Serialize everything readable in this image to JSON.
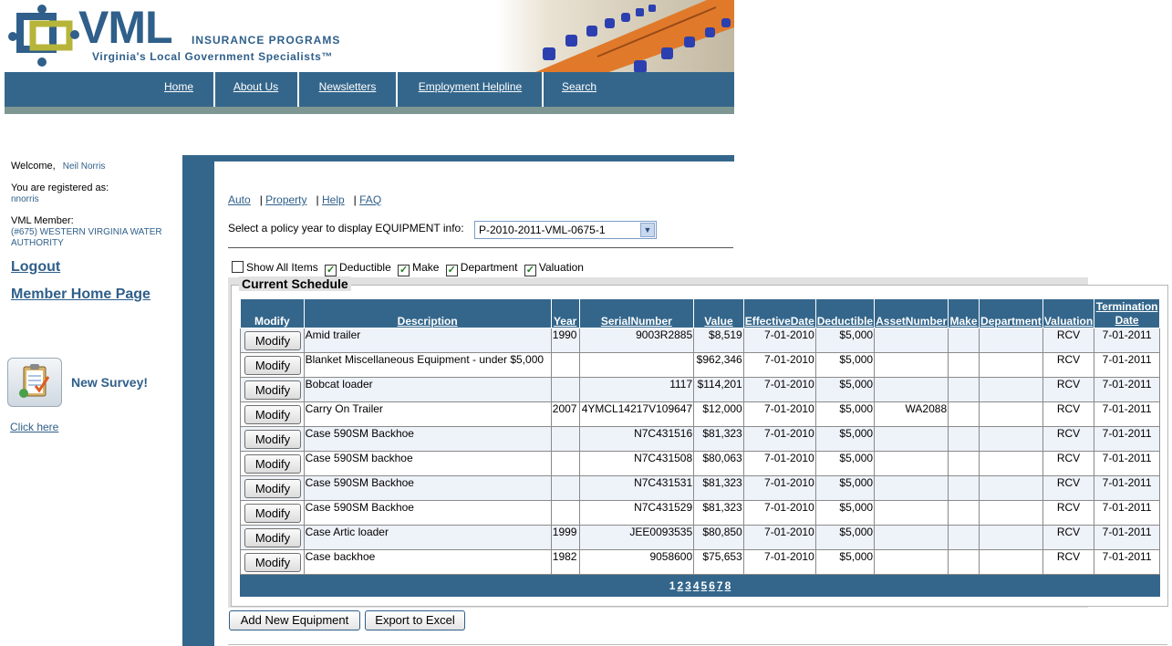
{
  "header": {
    "logo_text": "VML",
    "logo_sub1": "INSURANCE PROGRAMS",
    "logo_sub2": "Virginia's Local Government Specialists™"
  },
  "nav": [
    "Home",
    "About Us",
    "Newsletters",
    "Employment Helpline",
    "Search"
  ],
  "sidebar": {
    "welcome_label": "Welcome,",
    "welcome_name": "Neil Norris",
    "registered_label": "You are registered as:",
    "registered_user": "nnorris",
    "member_label": "VML Member:",
    "member_value": "(#675) WESTERN VIRGINIA WATER AUTHORITY",
    "logout": "Logout",
    "member_home": "Member Home Page",
    "survey_label": "New Survey!",
    "click_here": "Click here"
  },
  "topnav": [
    "Auto",
    "Property",
    "Help",
    "FAQ"
  ],
  "policy": {
    "label": "Select a policy year to display EQUIPMENT info:",
    "selected": "P-2010-2011-VML-0675-1"
  },
  "checkboxes": [
    {
      "label": "Show All Items",
      "checked": false
    },
    {
      "label": "Deductible",
      "checked": true
    },
    {
      "label": "Make",
      "checked": true
    },
    {
      "label": "Department",
      "checked": true
    },
    {
      "label": "Valuation",
      "checked": true
    }
  ],
  "schedule": {
    "legend": "Current Schedule",
    "columns": [
      "Modify",
      "Description",
      "Year",
      "SerialNumber",
      "Value",
      "EffectiveDate",
      "Deductible",
      "AssetNumber",
      "Make",
      "Department",
      "Valuation",
      "Termination Date"
    ],
    "modify_label": "Modify",
    "rows": [
      {
        "description": "Amid trailer",
        "year": "1990",
        "serial": "9003R2885",
        "value": "$8,519",
        "effective": "7-01-2010",
        "deductible": "$5,000",
        "asset": "",
        "make": "",
        "department": "",
        "valuation": "RCV",
        "termination": "7-01-2011"
      },
      {
        "description": "Blanket Miscellaneous Equipment - under $5,000",
        "year": "",
        "serial": "",
        "value": "$962,346",
        "effective": "7-01-2010",
        "deductible": "$5,000",
        "asset": "",
        "make": "",
        "department": "",
        "valuation": "RCV",
        "termination": "7-01-2011"
      },
      {
        "description": "Bobcat loader",
        "year": "",
        "serial": "1117",
        "value": "$114,201",
        "effective": "7-01-2010",
        "deductible": "$5,000",
        "asset": "",
        "make": "",
        "department": "",
        "valuation": "RCV",
        "termination": "7-01-2011"
      },
      {
        "description": "Carry On Trailer",
        "year": "2007",
        "serial": "4YMCL14217V109647",
        "value": "$12,000",
        "effective": "7-01-2010",
        "deductible": "$5,000",
        "asset": "WA2088",
        "make": "",
        "department": "",
        "valuation": "RCV",
        "termination": "7-01-2011"
      },
      {
        "description": "Case 590SM Backhoe",
        "year": "",
        "serial": "N7C431516",
        "value": "$81,323",
        "effective": "7-01-2010",
        "deductible": "$5,000",
        "asset": "",
        "make": "",
        "department": "",
        "valuation": "RCV",
        "termination": "7-01-2011"
      },
      {
        "description": "Case 590SM backhoe",
        "year": "",
        "serial": "N7C431508",
        "value": "$80,063",
        "effective": "7-01-2010",
        "deductible": "$5,000",
        "asset": "",
        "make": "",
        "department": "",
        "valuation": "RCV",
        "termination": "7-01-2011"
      },
      {
        "description": "Case 590SM Backhoe",
        "year": "",
        "serial": "N7C431531",
        "value": "$81,323",
        "effective": "7-01-2010",
        "deductible": "$5,000",
        "asset": "",
        "make": "",
        "department": "",
        "valuation": "RCV",
        "termination": "7-01-2011"
      },
      {
        "description": "Case 590SM Backhoe",
        "year": "",
        "serial": "N7C431529",
        "value": "$81,323",
        "effective": "7-01-2010",
        "deductible": "$5,000",
        "asset": "",
        "make": "",
        "department": "",
        "valuation": "RCV",
        "termination": "7-01-2011"
      },
      {
        "description": "Case Artic loader",
        "year": "1999",
        "serial": "JEE0093535",
        "value": "$80,850",
        "effective": "7-01-2010",
        "deductible": "$5,000",
        "asset": "",
        "make": "",
        "department": "",
        "valuation": "RCV",
        "termination": "7-01-2011"
      },
      {
        "description": "Case backhoe",
        "year": "1982",
        "serial": "9058600",
        "value": "$75,653",
        "effective": "7-01-2010",
        "deductible": "$5,000",
        "asset": "",
        "make": "",
        "department": "",
        "valuation": "RCV",
        "termination": "7-01-2011"
      }
    ],
    "pages": [
      "1",
      "2",
      "3",
      "4",
      "5",
      "6",
      "7",
      "8"
    ],
    "current_page": "1"
  },
  "buttons": {
    "add": "Add New Equipment",
    "export": "Export to Excel"
  },
  "colors": {
    "brand_blue": "#34668b",
    "link_blue": "#2f5f8a",
    "row_alt": "#eef2f9"
  }
}
